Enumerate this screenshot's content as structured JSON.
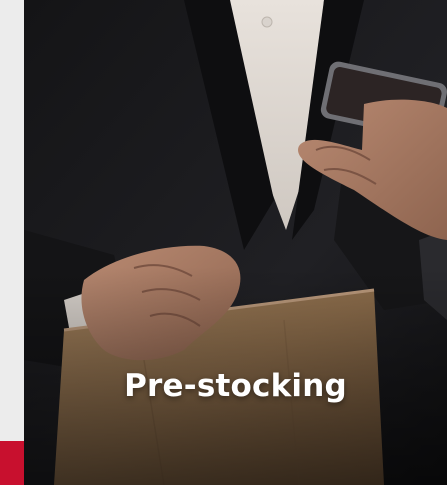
{
  "card": {
    "title": "Pre-stocking",
    "image_description_icon": "photo-businessman-phone-paper-bag"
  },
  "colors": {
    "accent": "#c8102e",
    "background": "#ececec",
    "title_text": "#ffffff"
  }
}
